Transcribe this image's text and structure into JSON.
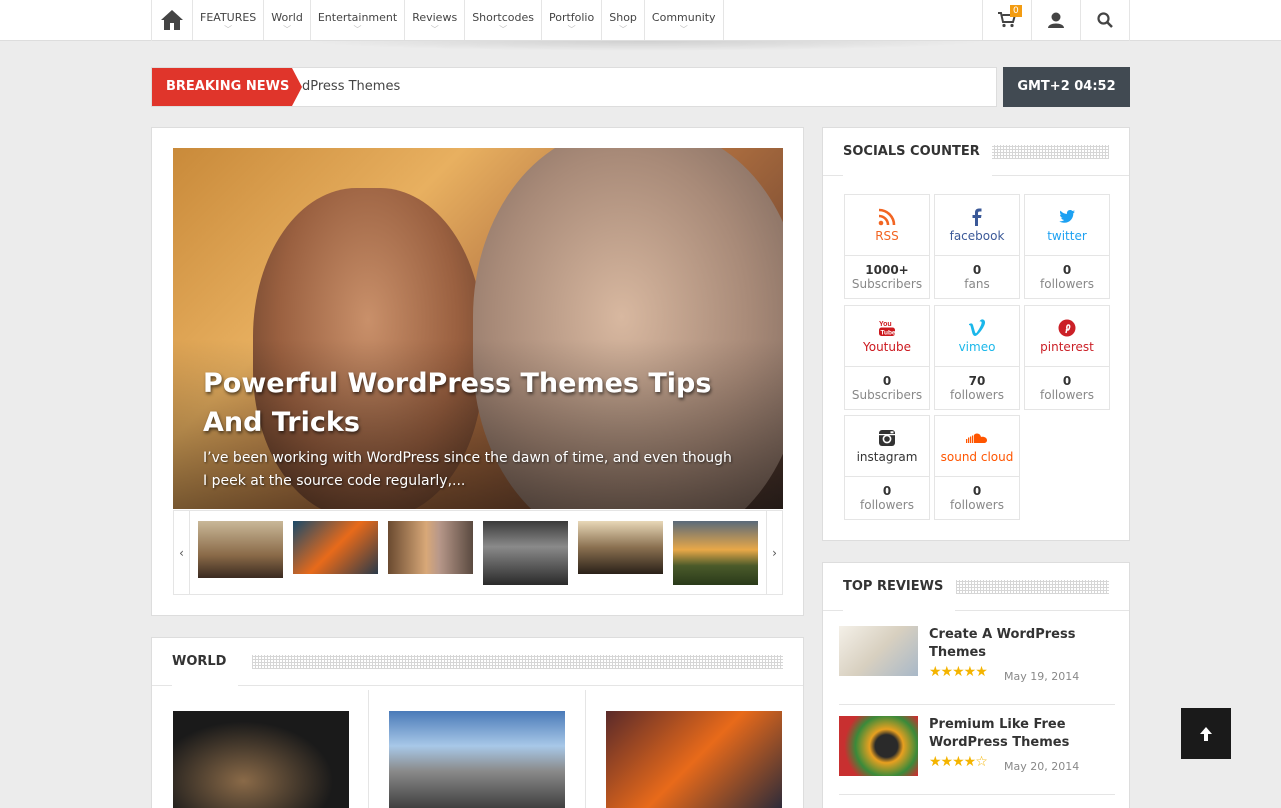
{
  "nav": {
    "items": [
      {
        "label": "FEATURES"
      },
      {
        "label": "World"
      },
      {
        "label": "Entertainment"
      },
      {
        "label": "Reviews"
      },
      {
        "label": "Shortcodes"
      },
      {
        "label": "Portfolio"
      },
      {
        "label": "Shop"
      },
      {
        "label": "Community"
      }
    ],
    "cart_count": "0"
  },
  "breaking": {
    "label": "BREAKING NEWS",
    "text": "dPress Themes"
  },
  "clock": "GMT+2 04:52",
  "slider": {
    "title": "Powerful WordPress Themes Tips And Tricks",
    "excerpt": "I’ve been working with WordPress since the dawn of time, and even though I peek at the source code regularly,..."
  },
  "world": {
    "title": "WORLD"
  },
  "socials": {
    "title": "SOCIALS COUNTER",
    "items": [
      {
        "name": "RSS",
        "count": "1000+",
        "unit": "Subscribers",
        "color": "#f26522"
      },
      {
        "name": "facebook",
        "count": "0",
        "unit": "fans",
        "color": "#3b5998"
      },
      {
        "name": "twitter",
        "count": "0",
        "unit": "followers",
        "color": "#1da1f2"
      },
      {
        "name": "Youtube",
        "count": "0",
        "unit": "Subscribers",
        "color": "#cc181e"
      },
      {
        "name": "vimeo",
        "count": "70",
        "unit": "followers",
        "color": "#1ab7ea"
      },
      {
        "name": "pinterest",
        "count": "0",
        "unit": "followers",
        "color": "#cb2027"
      },
      {
        "name": "instagram",
        "count": "0",
        "unit": "followers",
        "color": "#333333"
      },
      {
        "name": "sound cloud",
        "count": "0",
        "unit": "followers",
        "color": "#ff5500"
      }
    ]
  },
  "reviews": {
    "title": "TOP REVIEWS",
    "items": [
      {
        "title": "Create A WordPress Themes",
        "date": "May 19, 2014",
        "stars": "★★★★★"
      },
      {
        "title": "Premium Like Free WordPress Themes",
        "date": "May 20, 2014",
        "stars": "★★★★☆"
      }
    ]
  }
}
